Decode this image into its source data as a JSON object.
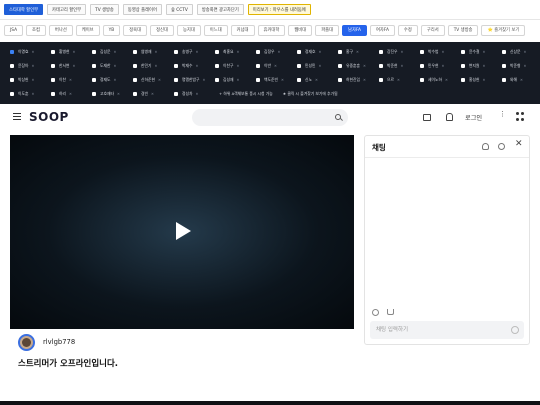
{
  "toolbar": {
    "buttons": [
      {
        "label": "스타대학 할인부",
        "style": "active"
      },
      {
        "label": "카테고리 할인부",
        "style": "normal"
      },
      {
        "label": "TV 생방송",
        "style": "normal"
      },
      {
        "label": "동영상 플레이어",
        "style": "normal"
      },
      {
        "label": "숲 CCTV",
        "style": "normal"
      },
      {
        "label": "방송화면 광고차단기",
        "style": "normal"
      },
      {
        "label": "미리보기 : 마우스를 내려둠에",
        "style": "highlight"
      }
    ]
  },
  "categories": {
    "items": [
      {
        "label": "JSA",
        "active": false
      },
      {
        "label": "조컵",
        "active": false
      },
      {
        "label": "버나선",
        "active": false
      },
      {
        "label": "케이브",
        "active": false
      },
      {
        "label": "YB",
        "active": false
      },
      {
        "label": "정육대",
        "active": false
      },
      {
        "label": "정신대",
        "active": false
      },
      {
        "label": "능지대",
        "active": false
      },
      {
        "label": "이느대",
        "active": false
      },
      {
        "label": "커넘대",
        "active": false
      },
      {
        "label": "휴커대학",
        "active": false
      },
      {
        "label": "웹비대",
        "active": false
      },
      {
        "label": "파플대",
        "active": false
      },
      {
        "label": "남자FA",
        "active": true
      },
      {
        "label": "여자FA",
        "active": false
      },
      {
        "label": "수정",
        "active": false
      },
      {
        "label": "구리서",
        "active": false
      },
      {
        "label": "TV 생방송",
        "active": false
      }
    ],
    "favorite_label": "⭐ 즐겨찾기 보기"
  },
  "chip_rows": [
    [
      {
        "label": "이명효",
        "on": true
      },
      {
        "label": "황병현",
        "on": false
      },
      {
        "label": "김성운",
        "on": false
      },
      {
        "label": "염병재",
        "on": false
      },
      {
        "label": "송병구",
        "on": false
      },
      {
        "label": "최홍요",
        "on": false
      },
      {
        "label": "김정우",
        "on": false
      },
      {
        "label": "정재호",
        "on": false
      },
      {
        "label": "홍구",
        "on": false
      },
      {
        "label": "장진우",
        "on": false
      },
      {
        "label": "박수범",
        "on": false
      },
      {
        "label": "윤수철",
        "on": false
      },
      {
        "label": "신상문",
        "on": false
      }
    ],
    [
      {
        "label": "윤장아",
        "on": false
      },
      {
        "label": "한서변",
        "on": false
      },
      {
        "label": "도재한",
        "on": false
      },
      {
        "label": "한민기",
        "on": false
      },
      {
        "label": "박재수",
        "on": false
      },
      {
        "label": "이찬구",
        "on": false
      },
      {
        "label": "이반",
        "on": false
      },
      {
        "label": "민성민",
        "on": false
      },
      {
        "label": "유중훈훈",
        "on": false
      },
      {
        "label": "박준현",
        "on": false
      },
      {
        "label": "민우현",
        "on": false
      },
      {
        "label": "변지원",
        "on": false
      },
      {
        "label": "박준형",
        "on": false
      }
    ],
    [
      {
        "label": "박상헌",
        "on": false
      },
      {
        "label": "이찬",
        "on": false
      },
      {
        "label": "정재도",
        "on": false
      },
      {
        "label": "신하준현",
        "on": false
      },
      {
        "label": "명맹한밤구",
        "on": false
      },
      {
        "label": "김성재",
        "on": false
      },
      {
        "label": "백도준빈",
        "on": false
      },
      {
        "label": "신노",
        "on": false
      },
      {
        "label": "허현진입",
        "on": false
      },
      {
        "label": "으르",
        "on": false
      },
      {
        "label": "세이노하",
        "on": false
      },
      {
        "label": "홍성헌",
        "on": false
      },
      {
        "label": "와해",
        "on": false
      }
    ],
    [
      {
        "label": "이도훈",
        "on": false
      },
      {
        "label": "하리",
        "on": false
      },
      {
        "label": "고호재타",
        "on": false
      },
      {
        "label": "경빈",
        "on": false
      },
      {
        "label": "정성차",
        "on": false
      }
    ]
  ],
  "chip_actions": {
    "add_all": "+ 하위 A객체보통 풍시 시청 가능",
    "favorite_add": "★ 클릭 시 즐겨찾기 보기에 추가됨"
  },
  "header": {
    "logo": "SOOP",
    "login_label": "로그인"
  },
  "player": {
    "streamer_name": "rlvlgb778",
    "offline_message": "스트리머가 오프라인입니다."
  },
  "chat": {
    "title": "채팅",
    "input_placeholder": "채팅 입력하기"
  },
  "colors": {
    "accent": "#1f6feb",
    "chip_panel_bg": "#161b24",
    "player_bg": "#0c151d"
  }
}
